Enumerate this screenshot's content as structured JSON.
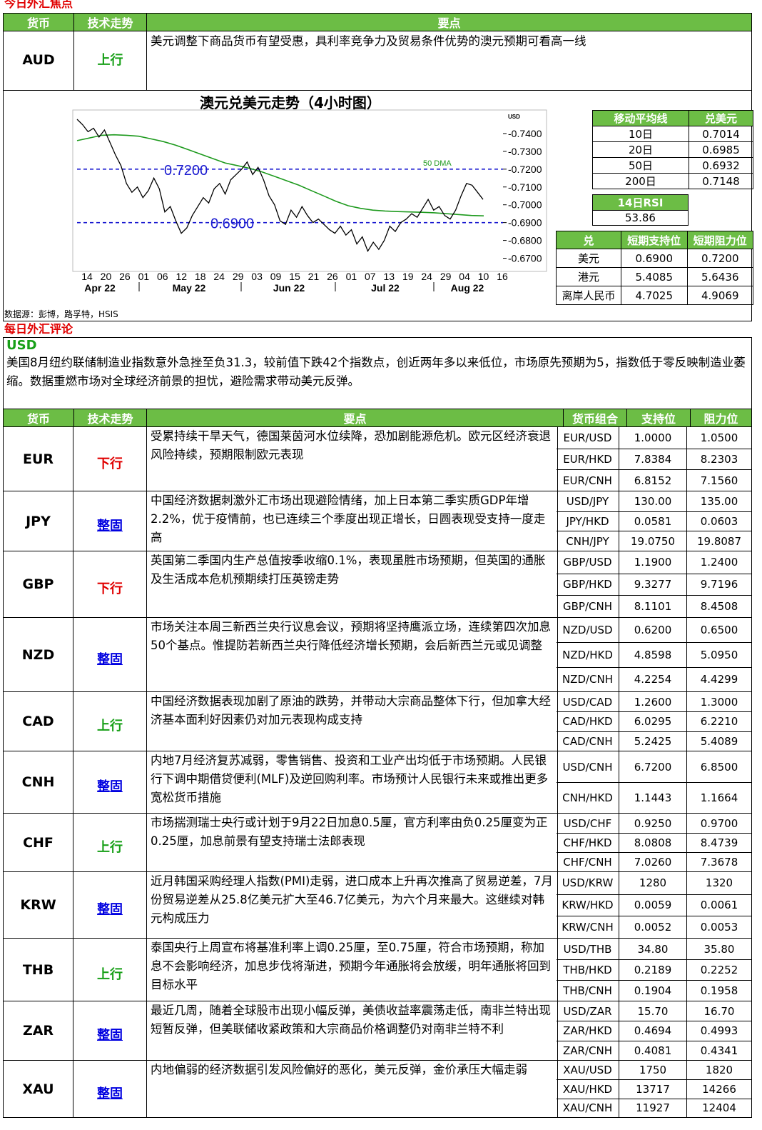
{
  "title_focus": "今日外汇焦点",
  "headers": {
    "currency": "货币",
    "trend": "技术走势",
    "points": "要点",
    "pair": "货币组合",
    "support": "支持位",
    "resistance": "阻力位"
  },
  "aud": {
    "currency": "AUD",
    "trend": "上行",
    "text": "美元调整下商品货币有望受惠，具利率竞争力及贸易条件优势的澳元预期可看高一线"
  },
  "chart_title": "澳元兑美元走势（4小时图）",
  "chart_data": {
    "type": "line",
    "unit_label": "USD",
    "yticks": [
      "0.7400",
      "0.7300",
      "0.7200",
      "0.7100",
      "0.7000",
      "0.6900",
      "0.6800",
      "0.6700"
    ],
    "ylim": [
      0.665,
      0.75
    ],
    "xticks": [
      "14",
      "20",
      "26",
      "01",
      "06",
      "12",
      "18",
      "24",
      "29",
      "03",
      "09",
      "15",
      "21",
      "26",
      "01",
      "07",
      "13",
      "19",
      "24",
      "29",
      "04",
      "10",
      "16"
    ],
    "months": [
      "Apr 22",
      "May 22",
      "Jun 22",
      "Jul 22",
      "Aug 22"
    ],
    "lines": [
      {
        "label": "0.7200",
        "value": 0.72
      },
      {
        "label": "0.6900",
        "value": 0.69
      }
    ],
    "ma_label": "50 DMA",
    "price": [
      0.748,
      0.745,
      0.741,
      0.743,
      0.738,
      0.742,
      0.735,
      0.728,
      0.722,
      0.712,
      0.707,
      0.71,
      0.704,
      0.708,
      0.715,
      0.709,
      0.696,
      0.699,
      0.691,
      0.684,
      0.687,
      0.694,
      0.699,
      0.704,
      0.701,
      0.709,
      0.712,
      0.706,
      0.714,
      0.717,
      0.72,
      0.724,
      0.717,
      0.721,
      0.714,
      0.705,
      0.7,
      0.691,
      0.689,
      0.697,
      0.693,
      0.699,
      0.694,
      0.69,
      0.692,
      0.689,
      0.686,
      0.684,
      0.688,
      0.683,
      0.686,
      0.678,
      0.682,
      0.674,
      0.679,
      0.675,
      0.68,
      0.688,
      0.685,
      0.69,
      0.692,
      0.695,
      0.693,
      0.698,
      0.703,
      0.697,
      0.699,
      0.694,
      0.692,
      0.697,
      0.705,
      0.712,
      0.711,
      0.707,
      0.703
    ],
    "ma50": [
      0.736,
      0.7375,
      0.739,
      0.7393,
      0.739,
      0.7385,
      0.737,
      0.7355,
      0.7335,
      0.731,
      0.7285,
      0.726,
      0.7235,
      0.722,
      0.7205,
      0.7185,
      0.716,
      0.7135,
      0.711,
      0.708,
      0.705,
      0.702,
      0.6995,
      0.698,
      0.697,
      0.6965,
      0.6962,
      0.696,
      0.6958,
      0.6955,
      0.695,
      0.6945,
      0.694,
      0.6938
    ]
  },
  "ma_table": {
    "h1": "移动平均线",
    "h2": "兑美元",
    "rows": [
      [
        "10日",
        "0.7014"
      ],
      [
        "20日",
        "0.6985"
      ],
      [
        "50日",
        "0.6932"
      ],
      [
        "200日",
        "0.7148"
      ]
    ],
    "rsi_label": "14日RSI",
    "rsi_value": "53.86"
  },
  "sr_table": {
    "h": [
      "兑",
      "短期支持位",
      "短期阻力位"
    ],
    "rows": [
      [
        "美元",
        "0.6900",
        "0.7200"
      ],
      [
        "港元",
        "5.4085",
        "5.6436"
      ],
      [
        "离岸人民币",
        "4.7025",
        "4.9069"
      ]
    ]
  },
  "source": "数据源：彭博，路孚特，HSIS",
  "title_comment": "每日外汇评论",
  "usd": {
    "label": "USD",
    "text": "美国8月纽约联储制造业指数意外急挫至负31.3，较前值下跌42个指数点，创近两年多以来低位，市场原先预期为5，指数低于零反映制造业萎缩。数据重燃市场对全球经济前景的担忧，避险需求带动美元反弹。"
  },
  "rows": [
    {
      "cur": "EUR",
      "trend": "下行",
      "cls": "down",
      "h": 90,
      "text": "受累持续干旱天气，德国莱茵河水位续降，恐加剧能源危机。欧元区经济衰退风险持续，预期限制欧元表现",
      "pairs": [
        [
          "EUR/USD",
          "1.0000",
          "1.0500"
        ],
        [
          "EUR/HKD",
          "7.8384",
          "8.2303"
        ],
        [
          "EUR/CNH",
          "6.8152",
          "7.1560"
        ]
      ]
    },
    {
      "cur": "JPY",
      "trend": "整固",
      "cls": "flat",
      "h": 84,
      "text": "中国经济数据刺激外汇市场出现避险情绪，加上日本第二季实质GDP年增2.2%，优于疫情前，也已连续三个季度出现正增长，日圆表现受支持一度走高",
      "pairs": [
        [
          "USD/JPY",
          "130.00",
          "135.00"
        ],
        [
          "JPY/HKD",
          "0.0581",
          "0.0603"
        ],
        [
          "CNH/JPY",
          "19.0750",
          "19.8087"
        ]
      ]
    },
    {
      "cur": "GBP",
      "trend": "下行",
      "cls": "down",
      "h": 93,
      "text": "英国第二季国内生产总值按季收缩0.1%，表现虽胜市场预期，但英国的通胀及生活成本危机预期续打压英镑走势",
      "pairs": [
        [
          "GBP/USD",
          "1.1900",
          "1.2400"
        ],
        [
          "GBP/HKD",
          "9.3277",
          "9.7196"
        ],
        [
          "GBP/CNH",
          "8.1101",
          "8.4508"
        ]
      ]
    },
    {
      "cur": "NZD",
      "trend": "整固",
      "cls": "flat",
      "h": 104,
      "text": "市场关注本周三新西兰央行议息会议，预期将坚持鹰派立场，连续第四次加息50个基点。惟提防若新西兰央行降低经济增长预期，会后新西兰元或见调整",
      "pairs": [
        [
          "NZD/USD",
          "0.6200",
          "0.6500"
        ],
        [
          "NZD/HKD",
          "4.8598",
          "5.0950"
        ],
        [
          "NZD/CNH",
          "4.2254",
          "4.4299"
        ]
      ]
    },
    {
      "cur": "CAD",
      "trend": "上行",
      "cls": "up",
      "h": 83,
      "text": "中国经济数据表现加剧了原油的跌势，并带动大宗商品整体下行，但加拿大经济基本面利好因素仍对加元表现构成支持",
      "pairs": [
        [
          "USD/CAD",
          "1.2600",
          "1.3000"
        ],
        [
          "CAD/HKD",
          "6.0295",
          "6.2210"
        ],
        [
          "CAD/CNH",
          "5.2425",
          "5.4089"
        ]
      ]
    },
    {
      "cur": "CNH",
      "trend": "整固",
      "cls": "flat",
      "h": 87,
      "text": "内地7月经济复苏减弱，零售销售、投资和工业产出均低于市场预期。人民银行下调中期借贷便利(MLF)及逆回购利率。市场预计人民银行未来或推出更多宽松货币措施",
      "pairs": [
        [
          "USD/CNH",
          "6.7200",
          "6.8500"
        ],
        [
          "CNH/HKD",
          "1.1443",
          "1.1664"
        ]
      ]
    },
    {
      "cur": "CHF",
      "trend": "上行",
      "cls": "up",
      "h": 82,
      "text": "市场揣测瑞士央行或计划于9月22日加息0.5厘，官方利率由负0.25厘变为正0.25厘，加息前景有望支持瑞士法郎表现",
      "pairs": [
        [
          "USD/CHF",
          "0.9250",
          "0.9700"
        ],
        [
          "CHF/HKD",
          "8.0808",
          "8.4739"
        ],
        [
          "CHF/CNH",
          "7.0260",
          "7.3678"
        ]
      ]
    },
    {
      "cur": "KRW",
      "trend": "整固",
      "cls": "flat",
      "h": 93,
      "text": "近月韩国采购经理人指数(PMI)走弱，进口成本上升再次推高了贸易逆差，7月份贸易逆差从25.8亿美元扩大至46.7亿美元，为六个月来最大。这继续对韩元构成压力",
      "pairs": [
        [
          "USD/KRW",
          "1280",
          "1320"
        ],
        [
          "KRW/HKD",
          "0.0059",
          "0.0061"
        ],
        [
          "KRW/CNH",
          "0.0052",
          "0.0053"
        ]
      ]
    },
    {
      "cur": "THB",
      "trend": "上行",
      "cls": "up",
      "h": 88,
      "text": "泰国央行上周宣布将基准利率上调0.25厘，至0.75厘，符合市场预期，称加息不会影响经济，加息步伐将渐进，预期今年通胀将会放缓，明年通胀将回到目标水平",
      "pairs": [
        [
          "USD/THB",
          "34.80",
          "35.80"
        ],
        [
          "THB/HKD",
          "0.2189",
          "0.2252"
        ],
        [
          "THB/CNH",
          "0.1904",
          "0.1958"
        ]
      ]
    },
    {
      "cur": "ZAR",
      "trend": "整固",
      "cls": "flat",
      "h": 83,
      "text": "最近几周，随着全球股市出现小幅反弹，美债收益率震荡走低，南非兰特出现短暂反弹，但美联储收紧政策和大宗商品价格调整仍对南非兰特不利",
      "pairs": [
        [
          "USD/ZAR",
          "15.70",
          "16.70"
        ],
        [
          "ZAR/HKD",
          "0.4694",
          "0.4993"
        ],
        [
          "ZAR/CNH",
          "0.4081",
          "0.4341"
        ]
      ]
    },
    {
      "cur": "XAU",
      "trend": "整固",
      "cls": "flat",
      "h": 80,
      "text": "内地偏弱的经济数据引发风险偏好的恶化，美元反弹，金价承压大幅走弱",
      "pairs": [
        [
          "XAU/USD",
          "1750",
          "1820"
        ],
        [
          "XAU/HKD",
          "13717",
          "14266"
        ],
        [
          "XAU/CNH",
          "11927",
          "12404"
        ]
      ]
    }
  ]
}
